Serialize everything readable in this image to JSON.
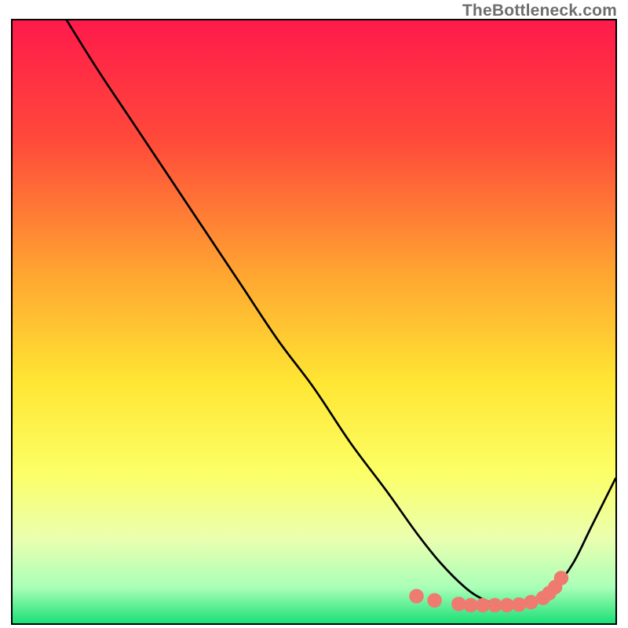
{
  "watermark": "TheBottleneck.com",
  "chart_data": {
    "type": "line",
    "title": "",
    "xlabel": "",
    "ylabel": "",
    "xlim": [
      0,
      100
    ],
    "ylim": [
      0,
      100
    ],
    "gradient_stops": [
      {
        "offset": 0.0,
        "color": "#ff1a4b"
      },
      {
        "offset": 0.2,
        "color": "#ff4a3a"
      },
      {
        "offset": 0.42,
        "color": "#ffa531"
      },
      {
        "offset": 0.6,
        "color": "#ffe633"
      },
      {
        "offset": 0.75,
        "color": "#fcff66"
      },
      {
        "offset": 0.86,
        "color": "#eaffb0"
      },
      {
        "offset": 0.94,
        "color": "#aaffb8"
      },
      {
        "offset": 1.0,
        "color": "#1be077"
      }
    ],
    "series": [
      {
        "name": "bottleneck-curve",
        "x": [
          9,
          14,
          20,
          26,
          32,
          38,
          44,
          50,
          56,
          62,
          67,
          71,
          75,
          78,
          81,
          84,
          87,
          90,
          93,
          96,
          100
        ],
        "y": [
          100,
          92,
          83,
          74,
          65,
          56,
          47,
          39,
          30,
          22,
          15,
          10,
          6,
          4,
          3,
          3,
          4,
          6,
          10,
          16,
          24
        ]
      }
    ],
    "markers": {
      "name": "highlight-dots",
      "color": "#ee7a70",
      "radius": 1.2,
      "x": [
        67,
        70,
        74,
        76,
        78,
        80,
        82,
        84,
        86,
        88,
        89,
        90,
        91
      ],
      "y": [
        4.5,
        3.8,
        3.2,
        3.0,
        3.0,
        3.0,
        3.0,
        3.1,
        3.5,
        4.2,
        5.0,
        6.0,
        7.5
      ]
    }
  }
}
